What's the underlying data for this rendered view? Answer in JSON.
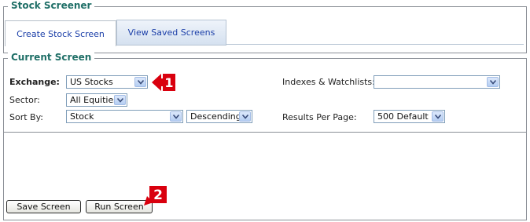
{
  "stock_screener": {
    "legend": "Stock Screener",
    "tabs": [
      {
        "label": "Create Stock Screen",
        "active": true
      },
      {
        "label": "View Saved Screens",
        "active": false
      }
    ]
  },
  "current_screen": {
    "legend": "Current Screen",
    "exchange": {
      "label": "Exchange:",
      "value": "US Stocks"
    },
    "sector": {
      "label": "Sector:",
      "value": "All Equities"
    },
    "sort_by": {
      "label": "Sort By:",
      "value": "Stock",
      "order": "Descending"
    },
    "indexes": {
      "label": "Indexes & Watchlists:",
      "value": ""
    },
    "results_per_page": {
      "label": "Results Per Page:",
      "value": "500 Default"
    },
    "buttons": {
      "save": "Save Screen",
      "run": "Run Screen"
    }
  },
  "annotations": [
    {
      "number": "1",
      "color": "#d9000e"
    },
    {
      "number": "2",
      "color": "#d9000e"
    }
  ],
  "colors": {
    "legend_text": "#1f6f67",
    "tab_text": "#1a3ea8",
    "annotation": "#d9000e"
  }
}
